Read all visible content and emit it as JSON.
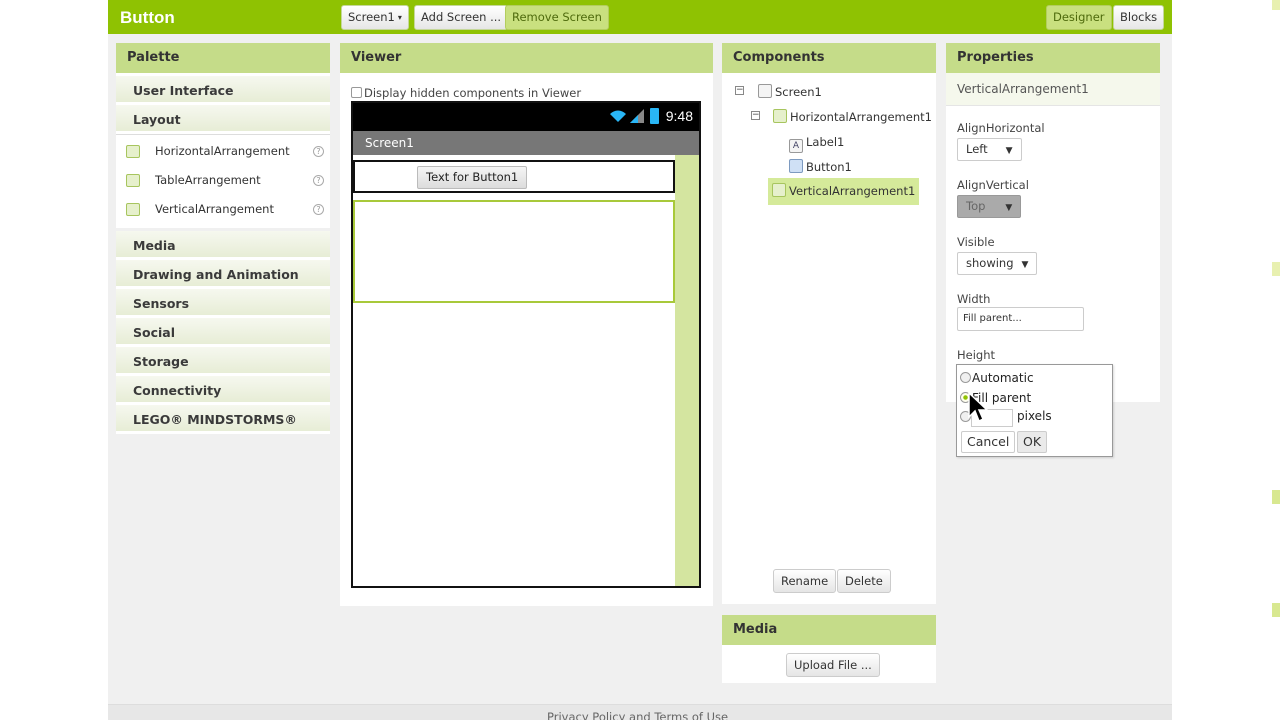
{
  "app_title": "Button",
  "toolbar": {
    "screen_select": "Screen1",
    "add_screen": "Add Screen ...",
    "remove_screen": "Remove Screen",
    "designer": "Designer",
    "blocks": "Blocks"
  },
  "palette": {
    "title": "Palette",
    "categories_top": [
      "User Interface",
      "Layout"
    ],
    "layout_items": [
      "HorizontalArrangement",
      "TableArrangement",
      "VerticalArrangement"
    ],
    "categories_bottom": [
      "Media",
      "Drawing and Animation",
      "Sensors",
      "Social",
      "Storage",
      "Connectivity",
      "LEGO® MINDSTORMS®"
    ]
  },
  "viewer": {
    "title": "Viewer",
    "hidden_label": "Display hidden components in Viewer",
    "time": "9:48",
    "screen_title": "Screen1",
    "button_text": "Text for Button1"
  },
  "components": {
    "title": "Components",
    "tree": [
      "Screen1",
      "HorizontalArrangement1",
      "Label1",
      "Button1",
      "VerticalArrangement1"
    ],
    "rename": "Rename",
    "delete": "Delete"
  },
  "media": {
    "title": "Media",
    "upload": "Upload File ..."
  },
  "properties": {
    "title": "Properties",
    "selected": "VerticalArrangement1",
    "align_horizontal_label": "AlignHorizontal",
    "align_horizontal_value": "Left",
    "align_vertical_label": "AlignVertical",
    "align_vertical_value": "Top",
    "visible_label": "Visible",
    "visible_value": "showing",
    "width_label": "Width",
    "width_value": "Fill parent...",
    "height_label": "Height"
  },
  "height_popup": {
    "automatic": "Automatic",
    "fill_parent": "Fill parent",
    "pixels": "pixels",
    "cancel": "Cancel",
    "ok": "OK"
  },
  "footer": "Privacy Policy and Terms of Use",
  "colors": {
    "brand_green": "#8fc202",
    "panel_header": "#c5dc89",
    "selection": "#d5ea9a"
  }
}
